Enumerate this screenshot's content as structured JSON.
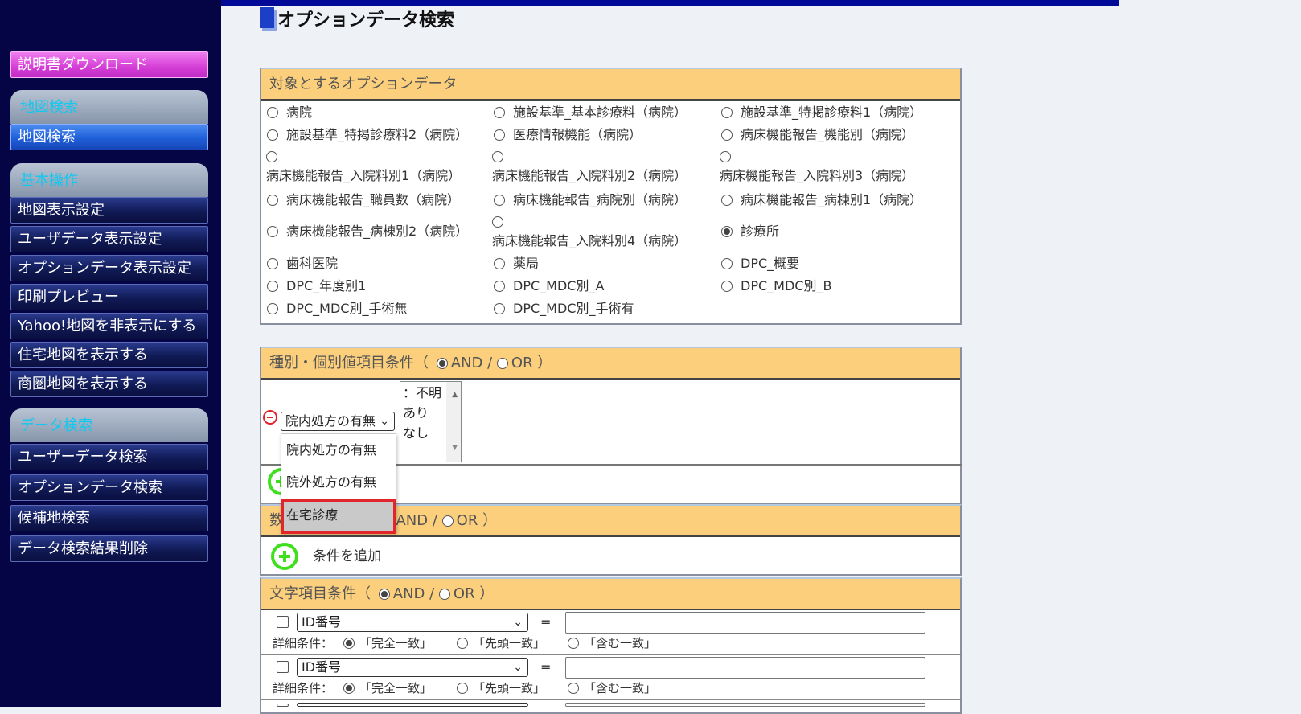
{
  "sidebar": {
    "manual_download": "説明書ダウンロード",
    "sections": [
      {
        "title": "地図検索",
        "items": [
          {
            "label": "地図検索",
            "active": true
          }
        ]
      },
      {
        "title": "基本操作",
        "items": [
          {
            "label": "地図表示設定"
          },
          {
            "label": "ユーザデータ表示設定"
          },
          {
            "label": "オプションデータ表示設定"
          },
          {
            "label": "印刷プレビュー"
          },
          {
            "label": "Yahoo!地図を非表示にする"
          },
          {
            "label": "住宅地図を表示する"
          },
          {
            "label": "商圏地図を表示する"
          }
        ]
      },
      {
        "title": "データ検索",
        "items": [
          {
            "label": "ユーザーデータ検索"
          },
          {
            "label": "オプションデータ検索"
          },
          {
            "label": "候補地検索"
          },
          {
            "label": "データ検索結果削除"
          }
        ]
      }
    ]
  },
  "page": {
    "title": "オプションデータ検索"
  },
  "target_panel": {
    "header": "対象とするオプションデータ",
    "selected": "診療所",
    "options": [
      "病院",
      "施設基準_基本診療料（病院）",
      "施設基準_特掲診療料1（病院）",
      "施設基準_特掲診療料2（病院）",
      "医療情報機能（病院）",
      "病床機能報告_機能別（病院）",
      "病床機能報告_入院料別1（病院）",
      "病床機能報告_入院料別2（病院）",
      "病床機能報告_入院料別3（病院）",
      "病床機能報告_職員数（病院）",
      "病床機能報告_病院別（病院）",
      "病床機能報告_病棟別1（病院）",
      "病床機能報告_病棟別2（病院）",
      "病床機能報告_入院料別4（病院）",
      "診療所",
      "歯科医院",
      "薬局",
      "DPC_概要",
      "DPC_年度別1",
      "DPC_MDC別_A",
      "DPC_MDC別_B",
      "DPC_MDC別_手術無",
      "DPC_MDC別_手術有"
    ]
  },
  "category_panel": {
    "header_prefix": "種別・個別値項目条件（",
    "and_label": "AND",
    "sep": "/",
    "or_label": "OR",
    "header_suffix": "）",
    "logic": "AND",
    "field_select": "院内処方の有無",
    "value_list": [
      "：不明",
      "あり",
      "なし"
    ],
    "dropdown_options": [
      "院内処方の有無",
      "院外処方の有無",
      "在宅診療"
    ],
    "highlighted_option": "在宅診療"
  },
  "numeric_panel": {
    "header_prefix": "数",
    "and_label": "AND",
    "sep": "/",
    "or_label": "OR",
    "header_suffix": "）",
    "add_label": "条件を追加"
  },
  "text_panel": {
    "header_prefix": "文字項目条件（",
    "and_label": "AND",
    "sep": "/",
    "or_label": "OR",
    "header_suffix": "）",
    "rows": [
      {
        "field": "ID番号",
        "op": "=",
        "value": "",
        "detail_label": "詳細条件：",
        "match_options": [
          "「完全一致」",
          "「先頭一致」",
          "「含む一致」"
        ],
        "match_selected": 0
      },
      {
        "field": "ID番号",
        "op": "=",
        "value": "",
        "detail_label": "詳細条件：",
        "match_options": [
          "「完全一致」",
          "「先頭一致」",
          "「含む一致」"
        ],
        "match_selected": 0
      }
    ]
  },
  "colors": {
    "sidebar_bg": "#050545",
    "panel_header": "#fccf7c",
    "accent": "#1b3fc7",
    "add_green": "#3ee01e",
    "remove_red": "#e2202a",
    "highlight_border": "#e0262a"
  }
}
